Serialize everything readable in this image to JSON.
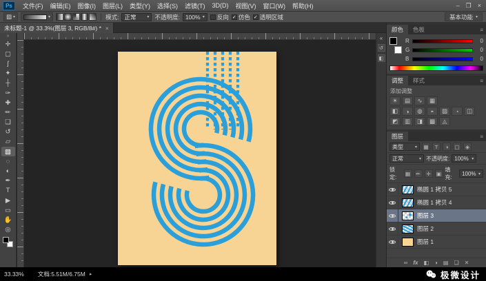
{
  "glyphs": {
    "collapse": "»",
    "expand": "«",
    "panel_menu": "≡",
    "dropdown": "▾",
    "check": "✓",
    "arrow": "▸",
    "min": "–",
    "max": "❐",
    "close": "×",
    "history": "↺",
    "properties": "◧"
  },
  "menu": {
    "logo": "Ps",
    "items": [
      "文件(F)",
      "编辑(E)",
      "图像(I)",
      "图层(L)",
      "类型(Y)",
      "选择(S)",
      "滤镜(T)",
      "3D(D)",
      "视图(V)",
      "窗口(W)",
      "帮助(H)"
    ]
  },
  "options": {
    "mode_label": "模式:",
    "mode_value": "正常",
    "opacity_label": "不透明度:",
    "opacity_value": "100%",
    "checks": [
      {
        "label": "反向",
        "checked": false
      },
      {
        "label": "仿色",
        "checked": true
      },
      {
        "label": "透明区域",
        "checked": true
      }
    ],
    "workspace": "基本功能"
  },
  "doc_tab": {
    "title": "未标题-1 @ 33.3%(图层 3, RGB/8#) *"
  },
  "toolbar": {
    "tools": [
      {
        "name": "move",
        "glyph": "✛"
      },
      {
        "name": "marquee",
        "glyph": "▢"
      },
      {
        "name": "lasso",
        "glyph": "ʃ"
      },
      {
        "name": "quick-select",
        "glyph": "✦"
      },
      {
        "name": "crop",
        "glyph": "┼"
      },
      {
        "name": "eyedropper",
        "glyph": "✑"
      },
      {
        "name": "healing-brush",
        "glyph": "✚"
      },
      {
        "name": "brush",
        "glyph": "✏"
      },
      {
        "name": "clone-stamp",
        "glyph": "❏"
      },
      {
        "name": "history-brush",
        "glyph": "↺"
      },
      {
        "name": "eraser",
        "glyph": "▱"
      },
      {
        "name": "gradient",
        "glyph": "▧"
      },
      {
        "name": "blur",
        "glyph": "◌"
      },
      {
        "name": "dodge",
        "glyph": "◐"
      },
      {
        "name": "pen",
        "glyph": "✒"
      },
      {
        "name": "type",
        "glyph": "T"
      },
      {
        "name": "path-select",
        "glyph": "▶"
      },
      {
        "name": "shape",
        "glyph": "▭"
      },
      {
        "name": "hand",
        "glyph": "✋"
      },
      {
        "name": "zoom",
        "glyph": "◎"
      }
    ]
  },
  "panels": {
    "color": {
      "tab": "颜色",
      "tab2": "色板",
      "channels": [
        {
          "label": "R",
          "value": "0"
        },
        {
          "label": "G",
          "value": "0"
        },
        {
          "label": "B",
          "value": "0"
        }
      ]
    },
    "adjust": {
      "tab": "调整",
      "tab2": "样式",
      "title": "添加调整",
      "rows": [
        [
          "☀",
          "▤",
          "∿",
          "▦"
        ],
        [
          "◧",
          "◑",
          "◍",
          "◓",
          "▨",
          "◔",
          "◫"
        ],
        [
          "◩",
          "▥",
          "◨",
          "▩",
          "◬"
        ]
      ]
    },
    "layers": {
      "tab": "图层",
      "filter_label": "类型",
      "filter_icons": [
        "▦",
        "T",
        "◑",
        "▢",
        "◈"
      ],
      "blend": "正常",
      "opacity_label": "不透明度:",
      "opacity_value": "100%",
      "lock_label": "锁定:",
      "lock_icons": [
        "▦",
        "✏",
        "✛",
        "▣"
      ],
      "fill_label": "填充:",
      "fill_value": "100%",
      "items": [
        {
          "name": "椭圆 1 拷贝 5",
          "selected": false
        },
        {
          "name": "椭圆 1 拷贝 4",
          "selected": false
        },
        {
          "name": "图层 3",
          "selected": true
        },
        {
          "name": "图层 2",
          "selected": false
        },
        {
          "name": "图层 1",
          "selected": false
        }
      ],
      "footer_icons": [
        "∞",
        "fx",
        "◧",
        "◑",
        "▤",
        "❏",
        "✕"
      ]
    }
  },
  "status": {
    "zoom": "33.33%",
    "doc": "文档:5.51M/6.75M"
  },
  "watermark": {
    "text": "极微设计"
  },
  "colors": {
    "artboard": "#f7d493",
    "stripe_blue": "#2b9fd9"
  }
}
